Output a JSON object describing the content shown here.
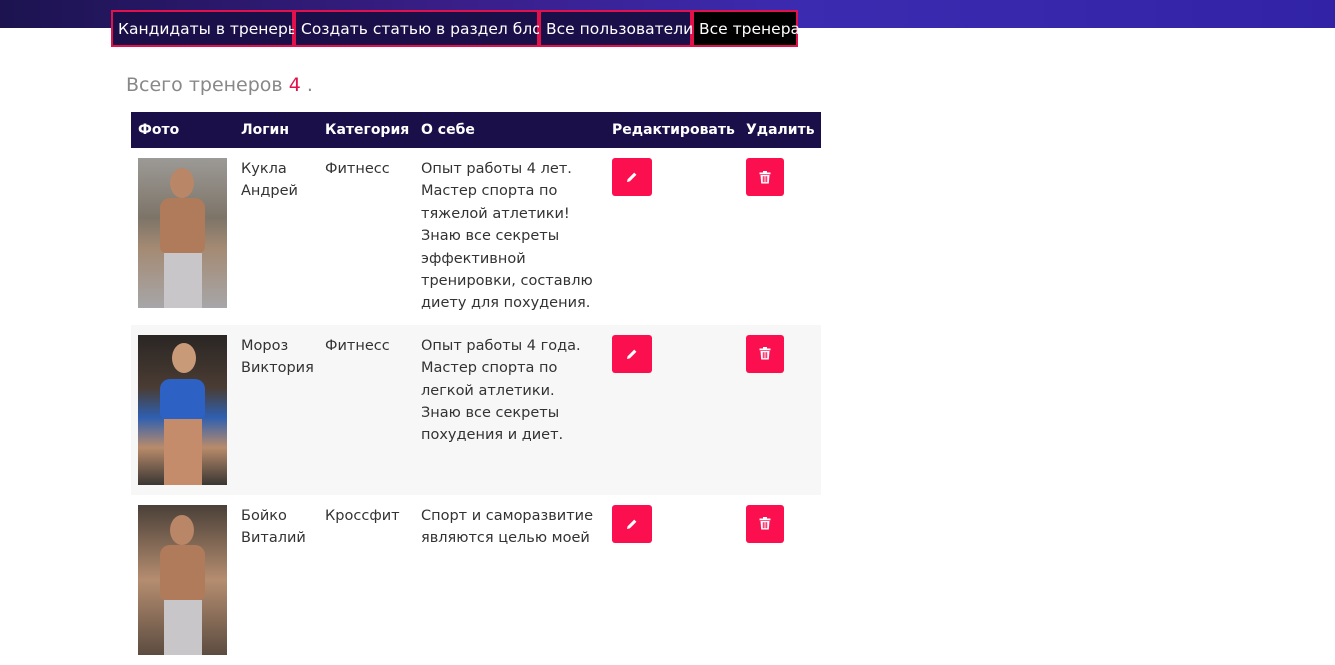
{
  "nav": {
    "items": [
      {
        "label": "Кандидаты в тренеры"
      },
      {
        "label": "Создать статью в раздел блог"
      },
      {
        "label": "Все пользователи"
      },
      {
        "label": "Все тренера"
      }
    ]
  },
  "summary": {
    "prefix": "Всего тренеров",
    "count": "4",
    "suffix": "."
  },
  "table": {
    "headers": {
      "photo": "Фото",
      "login": "Логин",
      "category": "Категория",
      "about": "О себе",
      "edit": "Редактировать",
      "delete": "Удалить"
    },
    "rows": [
      {
        "login": "Кукла Андрей",
        "category": "Фитнесс",
        "about": "Опыт работы 4 лет. Мастер спорта по тяжелой атлетики! Знаю все секреты эффективной тренировки, составлю диету для похудения."
      },
      {
        "login": "Мороз Виктория",
        "category": "Фитнесс",
        "about": "Опыт работы 4 года. Мастер спорта по легкой атлетики. Знаю все секреты похудения и диет."
      },
      {
        "login": "Бойко Виталий",
        "category": "Кроссфит",
        "about": "Спорт и саморазвитие являются целью моей"
      }
    ]
  },
  "colors": {
    "header_bg": "#1b0f4a",
    "accent": "#fb0f4f",
    "nav_border": "#e0114b"
  },
  "icons": {
    "edit": "pencil-icon",
    "delete": "trash-icon"
  }
}
